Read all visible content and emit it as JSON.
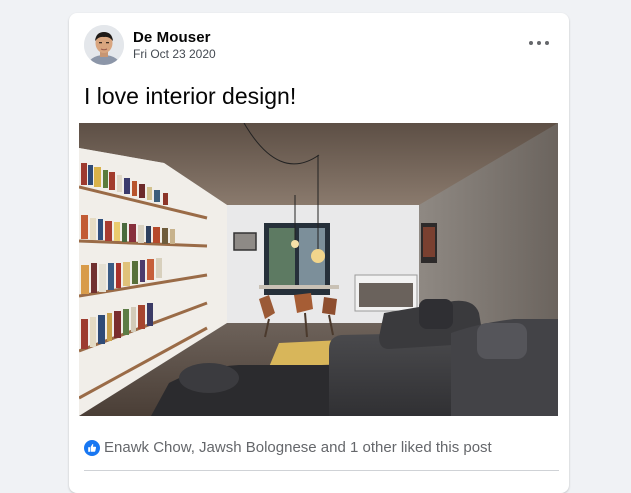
{
  "post": {
    "author": "De Mouser",
    "date": "Fri Oct 23 2020",
    "text": "I love interior design!",
    "likes_text": "Enawk Chow, Jawsh Bolognese and 1 other liked this post"
  },
  "icons": {
    "more": "more-options-icon",
    "like": "thumbs-up-icon"
  },
  "colors": {
    "like_blue": "#1877f2",
    "page_bg": "#f0f2f5"
  }
}
